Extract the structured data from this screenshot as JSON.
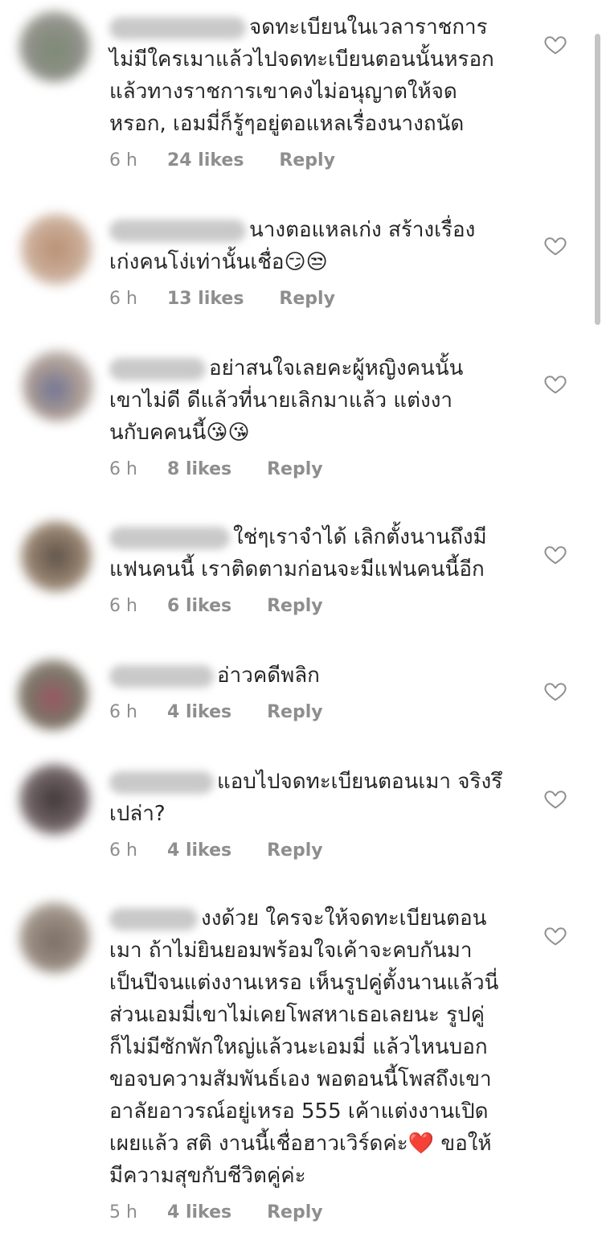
{
  "colors": {
    "text": "#262626",
    "meta": "#8e8e8e",
    "heart_like": "#e0245e"
  },
  "comments": [
    {
      "text": "จดทะเบียนในเวลาราชการ\nไม่มีใครเมาแล้วไปจดทะเบียนตอนนั้นหรอก\nแล้วทางราชการเขาคงไม่อนุญาตให้จด\nหรอก, เอมมี่ก็รู้ๆอยู่ตอแหลเรื่องนางถนัด",
      "time": "6 h",
      "likes": "24 likes",
      "reply": "Reply"
    },
    {
      "text": "นางตอแหลเก่ง สร้างเรื่อง\nเก่งคนโง่เท่านั้นเชื่อ",
      "emoji": "😏😒",
      "time": "6 h",
      "likes": "13 likes",
      "reply": "Reply"
    },
    {
      "text": "อย่าสนใจเลยคะผู้หญิงคนนั้น\nเขาไม่ดี ดีแล้วที่นายเลิกมาแล้ว แต่งงา\nนกับคคนนี้",
      "emoji": "😘😘",
      "time": "6 h",
      "likes": "8 likes",
      "reply": "Reply"
    },
    {
      "text": "ใช่ๆเราจำได้ เลิกตั้งนานถึงมี\nแฟนคนนี้ เราติดตามก่อนจะมีแฟนคนนี้อีก",
      "time": "6 h",
      "likes": "6 likes",
      "reply": "Reply"
    },
    {
      "text": "อ่าวคดีพลิก",
      "time": "6 h",
      "likes": "4 likes",
      "reply": "Reply"
    },
    {
      "text": "แอบไปจดทะเบียนตอนเมา จริงรึ\nเปล่า?",
      "time": "6 h",
      "likes": "4 likes",
      "reply": "Reply"
    },
    {
      "text": "งงด้วย ใครจะให้จดทะเบียนตอน\nเมา ถ้าไม่ยินยอมพร้อมใจเค้าจะคบกันมา\nเป็นปีจนแต่งงานเหรอ เห็นรูปคู่ตั้งนานแล้วนี่\nส่วนเอมมี่เขาไม่เคยโพสหาเธอเลยนะ รูปคู่\nก็ไม่มีซักพักใหญ่แล้วนะเอมมี่ แล้วไหนบอก\nขอจบความสัมพันธ์เอง พอตอนนี้โพสถึงเขา\nอาลัยอาวรณ์อยู่เหรอ 555 เค้าแต่งงานเปิด\nเผยแล้ว สติ งานนี้เชื่อฮาวเวิร์ดค่ะ",
      "emoji": "❤️",
      "text_after_emoji": " ขอให้\nมีความสุขกับชีวิตคู่ค่ะ",
      "time": "5 h",
      "likes": "4 likes",
      "reply": "Reply"
    }
  ]
}
